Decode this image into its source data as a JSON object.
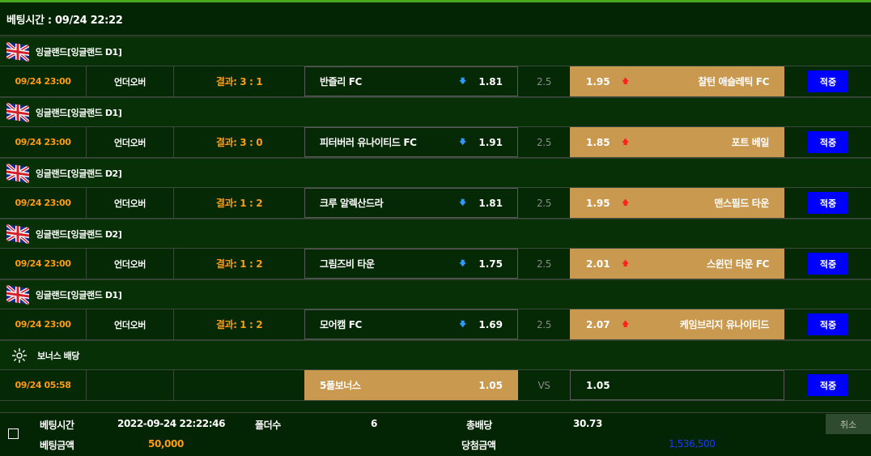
{
  "header": {
    "bet_time_label": "베팅시간 : 09/24 22:22"
  },
  "leagues": [
    {
      "name": "잉글랜드[잉글랜드 D1]"
    },
    {
      "name": "잉글랜드[잉글랜드 D1]"
    },
    {
      "name": "잉글랜드[잉글랜드 D2]"
    },
    {
      "name": "잉글랜드[잉글랜드 D2]"
    },
    {
      "name": "잉글랜드[잉글랜드 D1]"
    },
    {
      "name": "보너스 배당"
    }
  ],
  "rows": [
    {
      "time": "09/24 23:00",
      "type": "언더오버",
      "result": "결과: 3 : 1",
      "home": "반즐리 FC",
      "home_arrow": "down",
      "home_odd": "1.81",
      "draw": "2.5",
      "away_odd": "1.95",
      "away_arrow": "up",
      "away": "찰턴 애슬레틱 FC",
      "selected": "away",
      "button": "적중"
    },
    {
      "time": "09/24 23:00",
      "type": "언더오버",
      "result": "결과: 3 : 0",
      "home": "피터버러 유나이티드 FC",
      "home_arrow": "down",
      "home_odd": "1.91",
      "draw": "2.5",
      "away_odd": "1.85",
      "away_arrow": "up",
      "away": "포트 베일",
      "selected": "away",
      "button": "적중"
    },
    {
      "time": "09/24 23:00",
      "type": "언더오버",
      "result": "결과: 1 : 2",
      "home": "크루 알렉산드라",
      "home_arrow": "down",
      "home_odd": "1.81",
      "draw": "2.5",
      "away_odd": "1.95",
      "away_arrow": "up",
      "away": "맨스필드 타운",
      "selected": "away",
      "button": "적중"
    },
    {
      "time": "09/24 23:00",
      "type": "언더오버",
      "result": "결과: 1 : 2",
      "home": "그림즈비 타운",
      "home_arrow": "down",
      "home_odd": "1.75",
      "draw": "2.5",
      "away_odd": "2.01",
      "away_arrow": "up",
      "away": "스윈던 타운 FC",
      "selected": "away",
      "button": "적중"
    },
    {
      "time": "09/24 23:00",
      "type": "언더오버",
      "result": "결과: 1 : 2",
      "home": "모어캠 FC",
      "home_arrow": "down",
      "home_odd": "1.69",
      "draw": "2.5",
      "away_odd": "2.07",
      "away_arrow": "up",
      "away": "케임브리지 유나이티드",
      "selected": "away",
      "button": "적중"
    },
    {
      "time": "09/24 05:58",
      "type": "",
      "result": "",
      "home": "5폴보너스",
      "home_arrow": "",
      "home_odd": "1.05",
      "draw": "VS",
      "away_odd": "1.05",
      "away_arrow": "",
      "away": "",
      "selected": "home",
      "button": "적중"
    }
  ],
  "summary": {
    "bet_time_label": "베팅시간",
    "bet_time_value": "2022-09-24 22:22:46",
    "folder_label": "폴더수",
    "folder_value": "6",
    "total_odds_label": "총배당",
    "total_odds_value": "30.73",
    "bet_amount_label": "베팅금액",
    "bet_amount_value": "50,000",
    "win_amount_label": "당첨금액",
    "win_amount_value": "1,536,500",
    "cancel_label": "취소"
  },
  "icons": {
    "flag": "england-flag-icon",
    "bonus": "bonus-sparkle-icon",
    "down_arrow": "down-arrow-icon",
    "up_arrow": "up-arrow-icon"
  },
  "colors": {
    "background": "#062a06",
    "accent_orange": "#ff9c11",
    "selected_odd": "#c9994f",
    "button_blue": "#0000ff",
    "down_arrow": "#2e9aff",
    "up_arrow": "#ff2020",
    "win_amount": "#1a3aff"
  }
}
